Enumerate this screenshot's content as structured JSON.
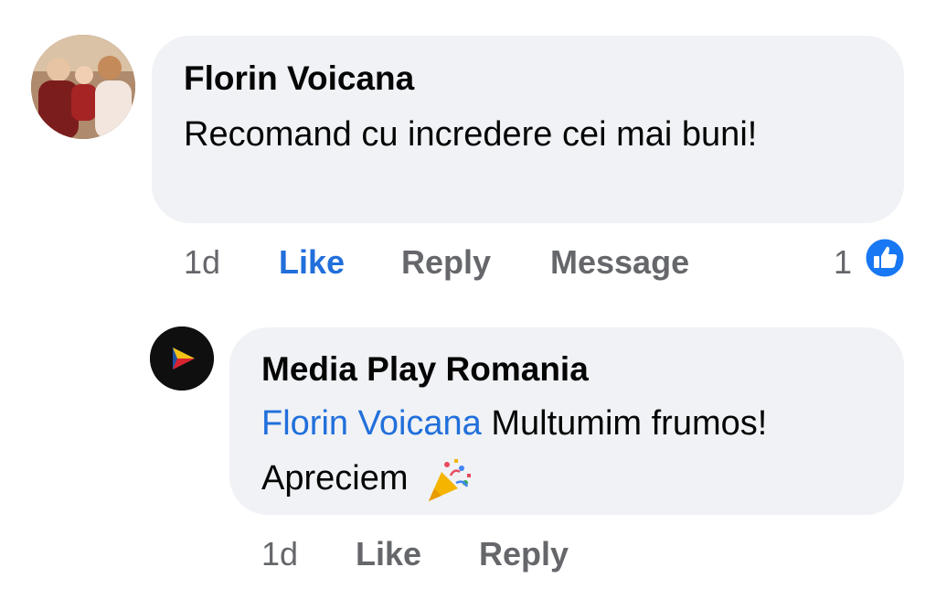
{
  "comment": {
    "author": "Florin Voicana",
    "text": "Recomand cu incredere cei mai buni!",
    "time": "1d",
    "like_label": "Like",
    "reply_label": "Reply",
    "message_label": "Message",
    "reaction_count": "1",
    "reaction_icon": "thumbs-up-icon"
  },
  "reply": {
    "author": "Media Play Romania",
    "mention": "Florin Voicana",
    "text": "Multumim frumos! Apreciem",
    "emoji": "party-popper-icon",
    "time": "1d",
    "like_label": "Like",
    "reply_label": "Reply"
  },
  "colors": {
    "accent": "#216fdb",
    "bubble": "#f0f2f5",
    "meta": "#65676b"
  }
}
